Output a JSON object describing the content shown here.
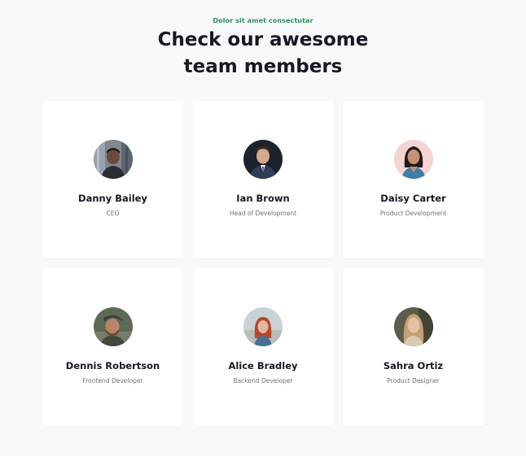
{
  "header": {
    "eyebrow": "Dolor sit amet consectutar",
    "title_line1": "Check our awesome",
    "title_line2": "team members"
  },
  "colors": {
    "accent": "#2f8f5b",
    "background": "#f7f8fa",
    "card": "#ffffff",
    "heading": "#151a22",
    "muted": "#6b717b"
  },
  "team": [
    {
      "name": "Danny Bailey",
      "role": "CEO"
    },
    {
      "name": "Ian Brown",
      "role": "Head of Development"
    },
    {
      "name": "Daisy Carter",
      "role": "Product Development"
    },
    {
      "name": "Dennis Robertson",
      "role": "Frontend Developer"
    },
    {
      "name": "Alice Bradley",
      "role": "Backend Developer"
    },
    {
      "name": "Sahra Ortiz",
      "role": "Product Designer"
    }
  ]
}
